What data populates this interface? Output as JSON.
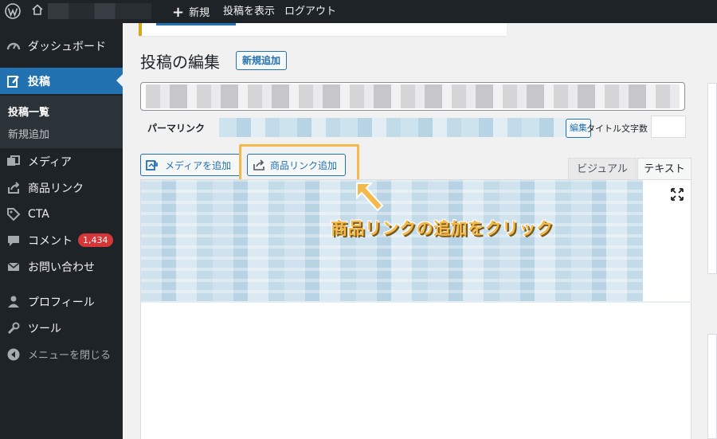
{
  "adminbar": {
    "new_label": "新規",
    "view_post_label": "投稿を表示",
    "logout_label": "ログアウト"
  },
  "sidebar": {
    "items": [
      {
        "label": "ダッシュボード",
        "icon": "dashboard-icon"
      },
      {
        "label": "投稿",
        "icon": "post-edit-icon"
      },
      {
        "label": "メディア",
        "icon": "media-icon"
      },
      {
        "label": "商品リンク",
        "icon": "share-link-icon"
      },
      {
        "label": "CTA",
        "icon": "tag-icon"
      },
      {
        "label": "コメント",
        "icon": "comment-icon",
        "badge": "1,434"
      },
      {
        "label": "お問い合わせ",
        "icon": "mail-icon"
      },
      {
        "label": "プロフィール",
        "icon": "user-icon"
      },
      {
        "label": "ツール",
        "icon": "wrench-icon"
      },
      {
        "label": "メニューを閉じる",
        "icon": "collapse-icon"
      }
    ],
    "submenu": [
      {
        "label": "投稿一覧"
      },
      {
        "label": "新規追加"
      }
    ]
  },
  "main": {
    "page_title": "投稿の編集",
    "add_new_label": "新規追加",
    "permalink_label": "パーマリンク",
    "edit_label": "編集",
    "char_count_label": "タイトル文字数",
    "add_media_label": "メディアを追加",
    "add_product_link_label": "商品リンク追加",
    "tab_visual": "ビジュアル",
    "tab_text": "テキスト"
  },
  "annotation": {
    "text": "商品リンクの追加をクリック"
  },
  "colors": {
    "admin_dark": "#1d2327",
    "accent_blue": "#2271b1",
    "highlight_orange": "#f5b94a",
    "badge_red": "#d63638"
  }
}
